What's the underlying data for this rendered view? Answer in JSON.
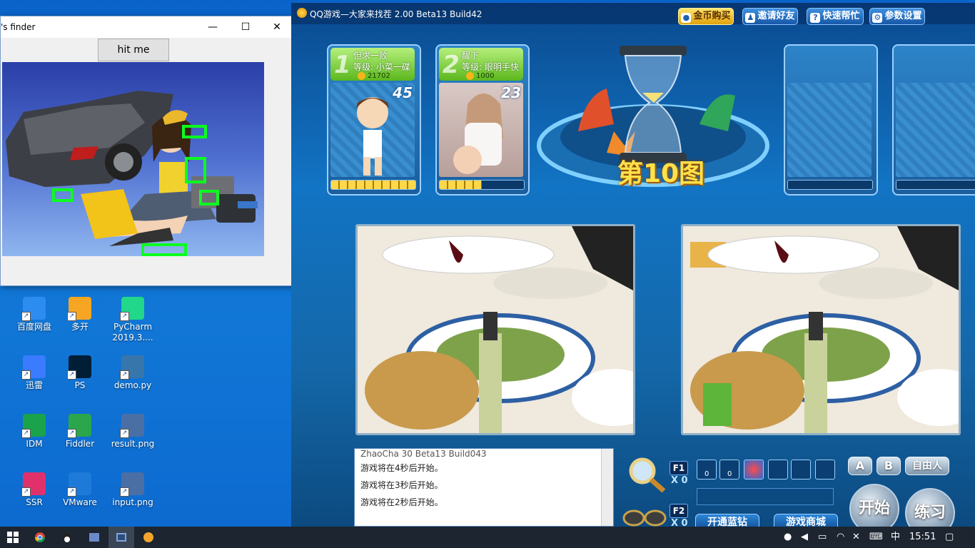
{
  "finder": {
    "title": "'s finder",
    "minimize": "—",
    "maximize": "☐",
    "close": "✕",
    "hit_button": "hit me"
  },
  "desktop_icons": [
    {
      "label": "百度网盘",
      "icon": "baidu-netdisk-icon",
      "color": "#2d8cf0"
    },
    {
      "label": "多开",
      "icon": "duokai-icon",
      "color": "#f6a623"
    },
    {
      "label": "PyCharm 2019.3....",
      "icon": "pycharm-icon",
      "color": "#21d789"
    },
    {
      "label": "迅雷",
      "icon": "xunlei-icon",
      "color": "#3a7bff"
    },
    {
      "label": "PS",
      "icon": "photoshop-icon",
      "color": "#001e36"
    },
    {
      "label": "demo.py",
      "icon": "python-file-icon",
      "color": "#3776ab"
    },
    {
      "label": "IDM",
      "icon": "idm-icon",
      "color": "#1aa34a"
    },
    {
      "label": "Fiddler",
      "icon": "fiddler-icon",
      "color": "#2ca64a"
    },
    {
      "label": "result.png",
      "icon": "image-file-icon",
      "color": "#4a6fa5"
    },
    {
      "label": "SSR",
      "icon": "ssr-icon",
      "color": "#e0316b"
    },
    {
      "label": "VMware",
      "icon": "vmware-icon",
      "color": "#1e7ad8"
    },
    {
      "label": "input.png",
      "icon": "image-file-icon",
      "color": "#4a6fa5"
    }
  ],
  "game": {
    "title": "QQ游戏—大家来找茬 2.00 Beta13 Build42",
    "buttons": {
      "buy_coins": "金币购买",
      "invite": "邀请好友",
      "help": "快速帮忙",
      "settings": "参数设置"
    },
    "players": [
      {
        "rank": "1",
        "name": "但求一败",
        "level": "等级: 小菜一碟",
        "coins": "21702",
        "score": "45",
        "progress": 1.0
      },
      {
        "rank": "2",
        "name": "醒下",
        "level": "等级: 眼明手快",
        "coins": "1000",
        "score": "23",
        "progress": 0.5
      }
    ],
    "round_label": "第10图",
    "chat": {
      "lines": [
        "ZhaoCha 30 Beta13 Build043",
        "游戏将在4秒后开始。",
        "游戏将在3秒后开始。",
        "游戏将在2秒后开始。"
      ]
    },
    "controls": {
      "f1": "F1",
      "f1_count": "X 0",
      "f2": "F2",
      "f2_count": "X 0",
      "btn_a": "A",
      "btn_b": "B",
      "btn_free": "自由人",
      "start": "开始",
      "practice": "练习",
      "blue_diamond": "开通蓝钻",
      "shop": "游戏商城",
      "item_count_1": "0",
      "item_count_2": "0"
    }
  },
  "taskbar": {
    "ime": "中",
    "time": "15:51"
  }
}
